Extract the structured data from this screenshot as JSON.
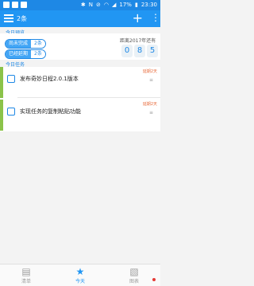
{
  "status_bar": {
    "battery": "17%",
    "time": "23:30",
    "icons": [
      "phone-icon",
      "app-notification-icon",
      "download-icon",
      "bluetooth-icon",
      "nfc-icon",
      "silent-icon",
      "wifi-icon",
      "signal-icon",
      "battery-icon"
    ]
  },
  "app_bar": {
    "count_label": "2条",
    "add_label": "+",
    "more_label": "⋮"
  },
  "overview": {
    "section_title": "今日预览",
    "stats": [
      {
        "label": "尚未完成",
        "count": "2条"
      },
      {
        "label": "已经延期",
        "count": "2条"
      }
    ],
    "countdown_label": "距离2017年还有",
    "countdown_digits": [
      "0",
      "8",
      "5"
    ]
  },
  "tasks": {
    "section_title": "今日任务",
    "items": [
      {
        "title": "发布奇妙日程2.0.1版本",
        "delay": "延期2天",
        "sub_icon": "≡"
      },
      {
        "title": "实现任务的复制粘贴功能",
        "delay": "延期2天",
        "sub_icon": "≡"
      }
    ]
  },
  "bottom_nav": {
    "items": [
      {
        "label": "清单",
        "icon": "list-icon"
      },
      {
        "label": "今天",
        "icon": "star-icon"
      },
      {
        "label": "图表",
        "icon": "chart-icon"
      }
    ],
    "active_index": 1
  },
  "colors": {
    "primary": "#2196f3",
    "status_bar": "#1e88e5",
    "task_marker": "#8bc34a",
    "delay_text": "#e86a3a"
  }
}
